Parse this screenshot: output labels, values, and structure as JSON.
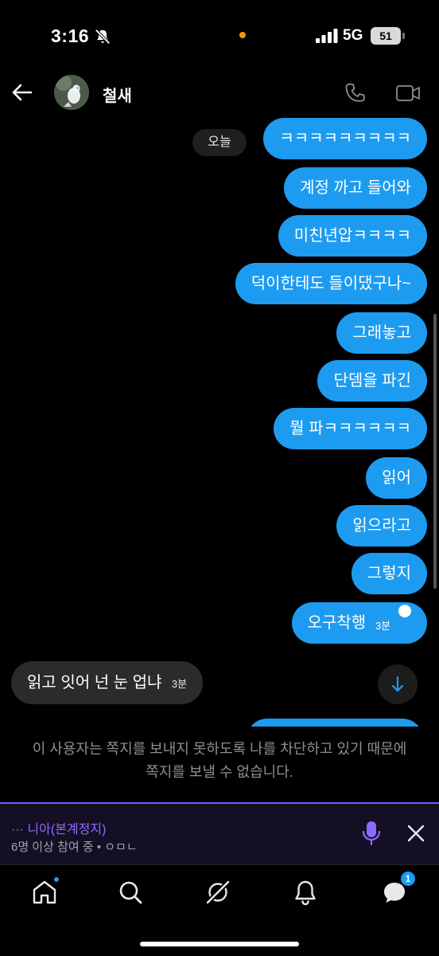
{
  "status_bar": {
    "time": "3:16",
    "network": "5G",
    "battery": "51"
  },
  "header": {
    "contact_name": "철새",
    "icons": {
      "back": "arrow-left-icon",
      "call": "phone-icon",
      "video": "video-camera-icon"
    }
  },
  "conversation": {
    "date_badge": "오늘",
    "outgoing": [
      {
        "text": "ㅋㅋㅋㅋㅋㅋㅋㅋㅋ"
      },
      {
        "text": "계정 까고 들어와"
      },
      {
        "text": "미친년압ㅋㅋㅋㅋ"
      },
      {
        "text": "덕이한테도 들이댔구나~"
      },
      {
        "text": "그래놓고"
      },
      {
        "text": "단뎀을 파긴"
      },
      {
        "text": "뭘 파ㅋㅋㅋㅋㅋㅋ"
      },
      {
        "text": "읽어"
      },
      {
        "text": "읽으라고"
      },
      {
        "text": "그렇지"
      },
      {
        "text": "오구착행",
        "time": "3분",
        "read": true
      }
    ],
    "incoming": {
      "text": "읽고 잇어 넌 눈 업냐",
      "time": "3분"
    }
  },
  "blocked_notice": "이 사용자는 쪽지를 보내지 못하도록 나를 차단하고 있기 때문에 쪽지를 보낼 수 없습니다.",
  "space": {
    "title": "··· 니아(본계정지)",
    "subtitle": "6명 이상 참여 중 • ㅇㅁㄴ"
  },
  "bottom_nav": {
    "items": [
      "home-icon",
      "search-icon",
      "grok-icon",
      "notifications-icon",
      "messages-icon"
    ],
    "messages_badge": "1"
  },
  "colors": {
    "accent": "#1d9bf0",
    "space_accent": "#7856ff",
    "incoming_bubble": "#2b2b2b",
    "background": "#000000"
  }
}
